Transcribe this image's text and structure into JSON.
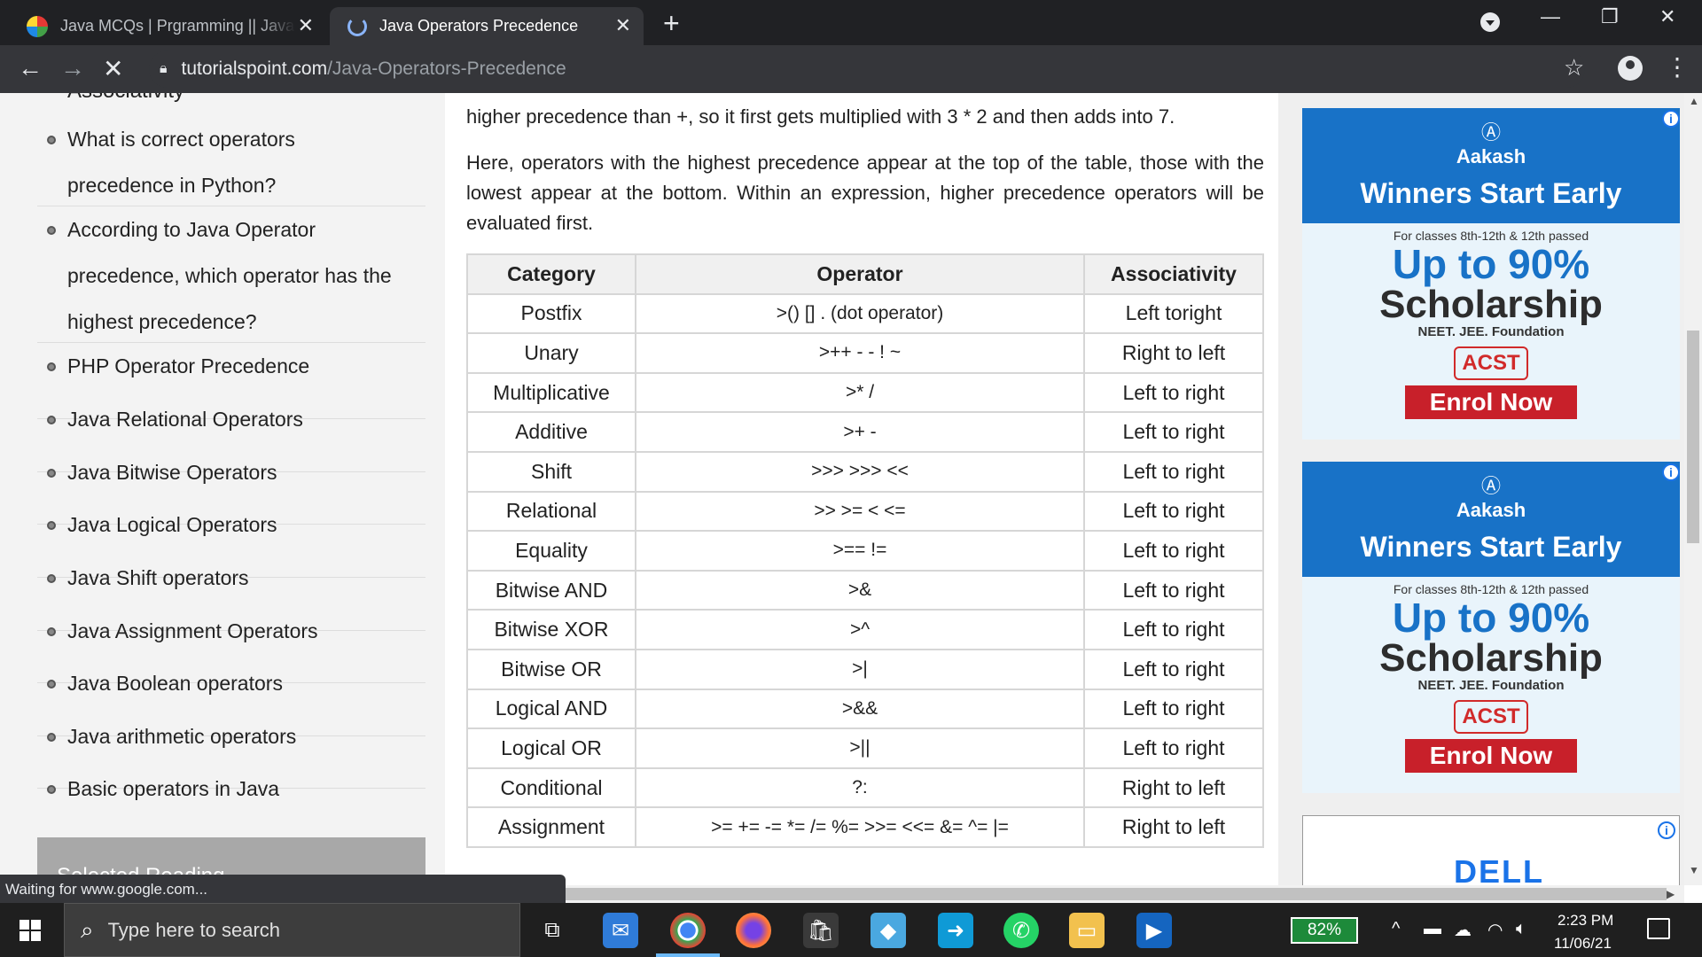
{
  "browser": {
    "tabs": [
      {
        "title": "Java MCQs | Prgramming || Java Programming",
        "close": "✕"
      },
      {
        "title": "Java Operators Precedence",
        "close": "✕"
      }
    ],
    "new_tab": "+",
    "url_host": "tutorialspoint.com",
    "url_path": "/Java-Operators-Precedence",
    "status": "Waiting for www.google.com..."
  },
  "sidebar": {
    "partial_item": "Associativity",
    "items": [
      "What is correct operators precedence in Python?",
      "According to Java Operator precedence, which operator has the highest precedence?",
      "PHP Operator Precedence",
      "Java Relational Operators",
      "Java Bitwise Operators",
      "Java Logical Operators",
      "Java Shift operators",
      "Java Assignment Operators",
      "Java Boolean operators",
      "Java arithmetic operators",
      "Basic operators in Java"
    ],
    "selected_reading": "Selected Reading"
  },
  "content": {
    "intro_cut": "higher precedence than +, so it first gets multiplied with 3 * 2 and then adds into 7.",
    "paragraph": "Here, operators with the highest precedence appear at the top of the table, those with the lowest appear at the bottom. Within an expression, higher precedence operators will be evaluated first.",
    "table": {
      "headers": [
        "Category",
        "Operator",
        "Associativity"
      ],
      "rows": [
        [
          "Postfix",
          ">() [] . (dot operator)",
          "Left toright"
        ],
        [
          "Unary",
          ">++ - - ! ~",
          "Right to left"
        ],
        [
          "Multiplicative",
          ">* /",
          "Left to right"
        ],
        [
          "Additive",
          ">+ -",
          "Left to right"
        ],
        [
          "Shift",
          ">>> >>> <<",
          "Left to right"
        ],
        [
          "Relational",
          ">> >= < <=",
          "Left to right"
        ],
        [
          "Equality",
          ">== !=",
          "Left to right"
        ],
        [
          "Bitwise AND",
          ">&",
          "Left to right"
        ],
        [
          "Bitwise XOR",
          ">^",
          "Left to right"
        ],
        [
          "Bitwise OR",
          ">|",
          "Left to right"
        ],
        [
          "Logical AND",
          ">&&",
          "Left to right"
        ],
        [
          "Logical OR",
          ">||",
          "Left to right"
        ],
        [
          "Conditional",
          "?:",
          "Right to left"
        ],
        [
          "Assignment",
          ">= += -= *= /= %= >>= <<= &= ^= |=",
          "Right to left"
        ]
      ]
    }
  },
  "ads": {
    "brand": "Aakash",
    "tagline": "Winners Start Early",
    "classes": "For classes 8th-12th & 12th passed",
    "headline1": "Up to 90%",
    "headline2": "Scholarship",
    "exams": "NEET. JEE. Foundation",
    "acst": "ACST",
    "cta": "Enrol Now",
    "info": "i",
    "dell": "DELL"
  },
  "taskbar": {
    "search_placeholder": "Type here to search",
    "battery": "82%",
    "time": "2:23 PM",
    "date": "11/06/21"
  },
  "colors": {
    "chrome_dark": "#202124",
    "ad_blue": "#1872c7",
    "ad_red": "#c8202a",
    "battery_green": "#1d8a3a"
  }
}
